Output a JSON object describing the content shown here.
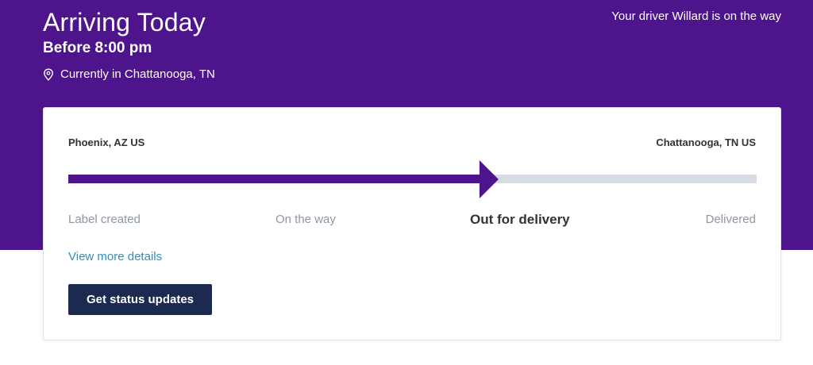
{
  "header": {
    "title": "Arriving Today",
    "subtitle": "Before 8:00 pm",
    "location_icon": "map-pin-icon",
    "location_text": "Currently in Chattanooga, TN",
    "driver_text": "Your driver Willard is on the way"
  },
  "tracking": {
    "origin": "Phoenix, AZ US",
    "destination": "Chattanooga, TN US",
    "progress_fraction": 0.625,
    "stages": [
      "Label created",
      "On the way",
      "Out for delivery",
      "Delivered"
    ],
    "current_stage_index": 2,
    "details_link": "View more details",
    "status_button": "Get status updates"
  },
  "colors": {
    "brand_purple": "#4d148c",
    "progress_track": "#d6dae2",
    "link": "#2f8fbf",
    "button": "#1b2a4e"
  }
}
